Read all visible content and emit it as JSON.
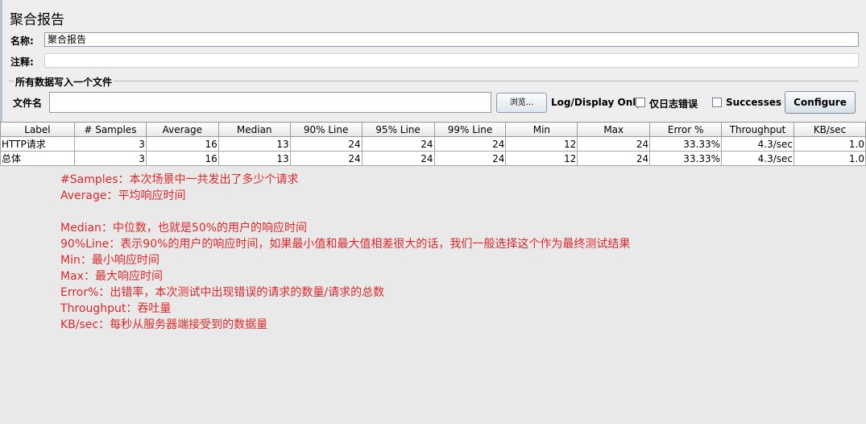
{
  "title": "聚合报告",
  "name_field": {
    "label": "名称:",
    "value": "聚合报告"
  },
  "comment_field": {
    "label": "注释:",
    "value": ""
  },
  "file_group": {
    "legend": "所有数据写入一个文件",
    "file_label": "文件名",
    "file_value": "",
    "browse_label": "浏览...",
    "log_display_label": "Log/Display Only:",
    "errors_only_label": "仅日志错误",
    "successes_label": "Successes",
    "configure_label": "Configure"
  },
  "table": {
    "columns": [
      "Label",
      "# Samples",
      "Average",
      "Median",
      "90% Line",
      "95% Line",
      "99% Line",
      "Min",
      "Max",
      "Error %",
      "Throughput",
      "KB/sec"
    ],
    "rows": [
      [
        "HTTP请求",
        "3",
        "16",
        "13",
        "24",
        "24",
        "24",
        "12",
        "24",
        "33.33%",
        "4.3/sec",
        "1.0"
      ],
      [
        "总体",
        "3",
        "16",
        "13",
        "24",
        "24",
        "24",
        "12",
        "24",
        "33.33%",
        "4.3/sec",
        "1.0"
      ]
    ]
  },
  "notes": [
    "#Samples：本次场景中一共发出了多少个请求",
    "Average：平均响应时间",
    "",
    "Median：中位数，也就是50%的用户的响应时间",
    "90%Line：表示90%的用户的响应时间，如果最小值和最大值相差很大的话，我们一般选择这个作为最终测试结果",
    "Min：最小响应时间",
    "Max：最大响应时间",
    "Error%：出错率，本次测试中出现错误的请求的数量/请求的总数",
    "Throughput：吞吐量",
    "KB/sec：每秒从服务器端接受到的数据量"
  ]
}
